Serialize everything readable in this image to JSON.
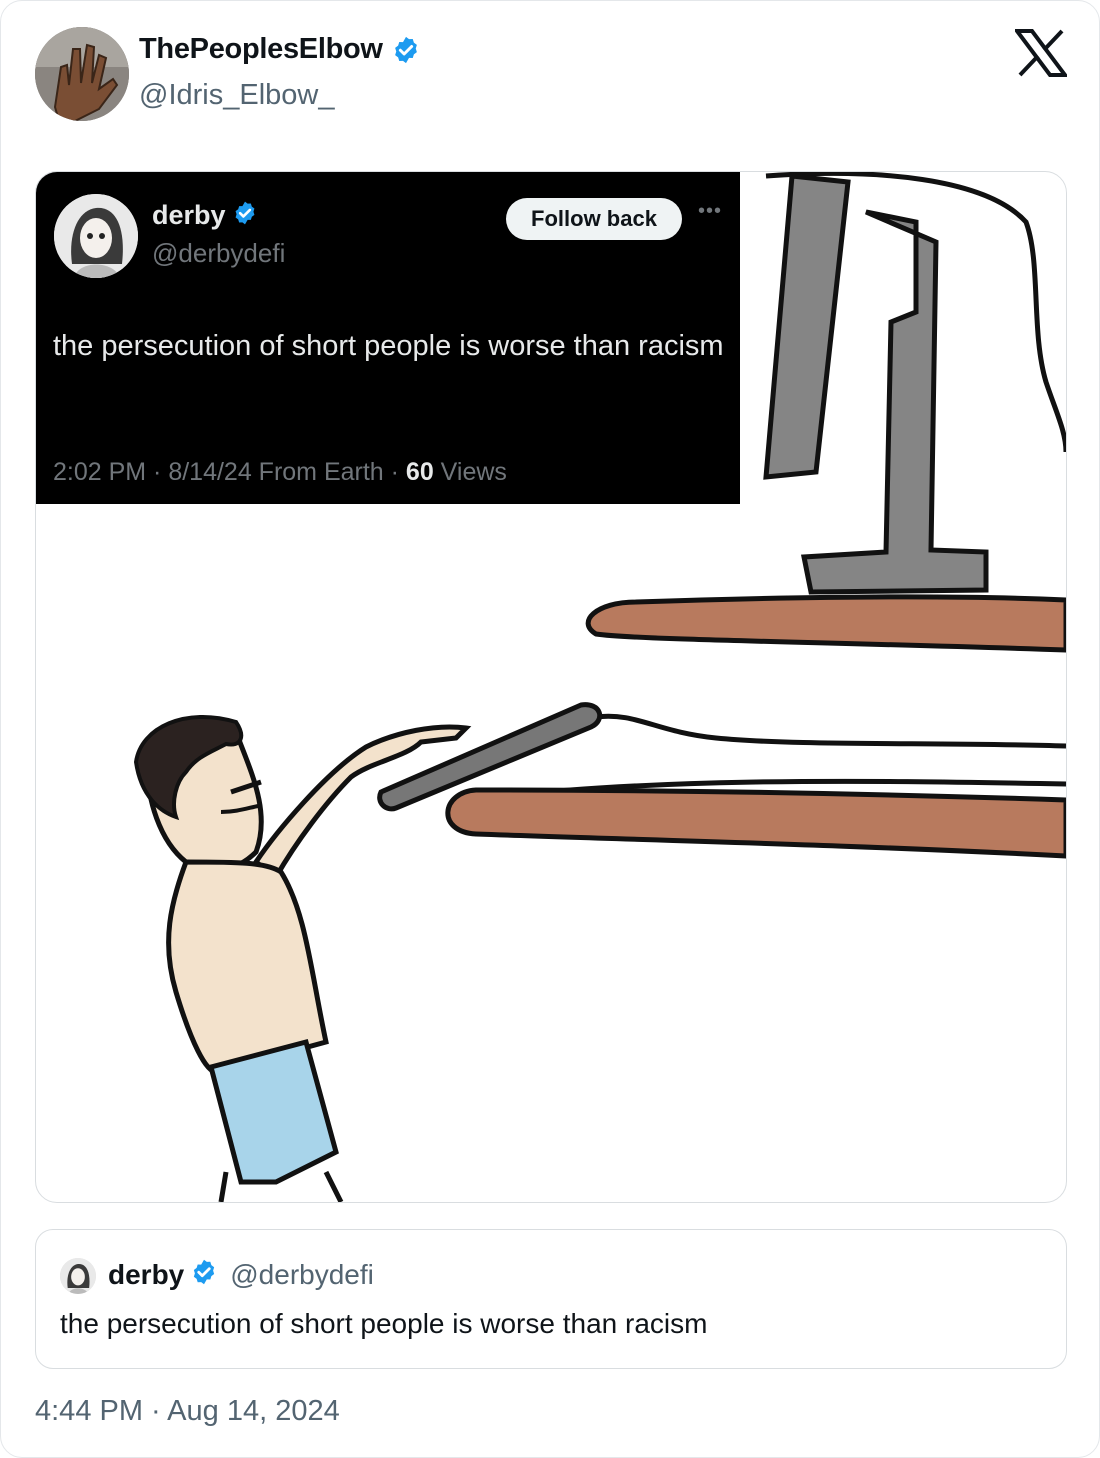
{
  "author": {
    "name": "ThePeoplesElbow",
    "handle": "@Idris_Elbow_",
    "verified": true
  },
  "platform_icon": "x-logo-icon",
  "media": {
    "embedded_tweet": {
      "name": "derby",
      "handle": "@derbydefi",
      "follow_label": "Follow back",
      "more_icon": "more-dots-icon",
      "text": "the persecution of short people is worse than racism",
      "meta_prefix": "2:02 PM · 8/14/24 From Earth · ",
      "views_count": "60",
      "views_label": " Views"
    }
  },
  "quote": {
    "name": "derby",
    "handle": "@derbydefi",
    "text": "the persecution of short people is worse than racism"
  },
  "timestamp": "4:44 PM · Aug 14, 2024",
  "colors": {
    "verified_blue": "#1d9bf0",
    "secondary_text": "#536471",
    "shelf_brown": "#b87a5e",
    "shorts_blue": "#a8d4ea",
    "skin": "#f3e2cc",
    "monitor_gray": "#858585"
  }
}
